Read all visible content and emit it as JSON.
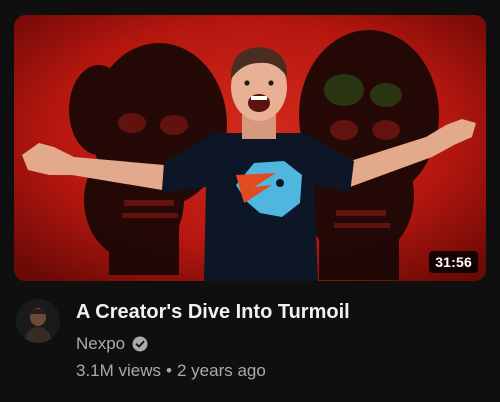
{
  "video": {
    "duration": "31:56",
    "title": "A Creator's Dive Into Turmoil",
    "channel": "Nexpo",
    "views": "3.1M views",
    "separator": "•",
    "age": "2 years ago"
  },
  "icons": {
    "verified": "verified-check-icon",
    "thumbnail_subject": "person-arms-outstretched",
    "shirt_logo": "lightning-beast-logo"
  },
  "colors": {
    "background": "#0f0f0f",
    "thumbnail_red": "#c11a12",
    "title_text": "#f1f1f1",
    "secondary_text": "#aaaaaa",
    "shirt": "#0d1626",
    "shirt_logo": "#4fb6e0"
  }
}
